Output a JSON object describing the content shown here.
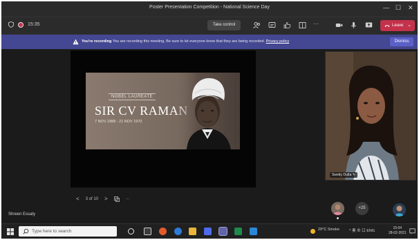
{
  "window": {
    "title": "Poster Presentation Competition - National Science Day",
    "controls": [
      "—",
      "☐",
      "✕"
    ]
  },
  "toolbar": {
    "timer": "15:35",
    "take_control_label": "Take control",
    "leave_label": "Leave",
    "leave_chevron": "⌄",
    "more_glyph": "···",
    "accent": "#c4314b"
  },
  "banner": {
    "bold": "You're recording",
    "message": " You are recording this meeting. Be sure to let everyone know that they are being recorded. ",
    "link": "Privacy policy",
    "dismiss_label": "Dismiss",
    "bg": "#444791"
  },
  "slide": {
    "subtitle": "NOBEL LAUREATE",
    "title": "SIR CV RAMAN",
    "dates": "7 NOV 1888 - 21 NOV 1970"
  },
  "slide_nav": {
    "prev": "<",
    "page": "3 of 10",
    "next": ">",
    "more": "···"
  },
  "share": {
    "shown_label": "Shreen Essaty"
  },
  "participant": {
    "name_tag": "Swetty Dutta"
  },
  "roster": {
    "more_count": "+25"
  },
  "taskbar": {
    "search_placeholder": "Type here to search",
    "weather": "29°C Smoke",
    "tray_icons": "^ 奥 ⊕ 口 ENG",
    "time": "15:04",
    "date": "28-02-2021"
  }
}
